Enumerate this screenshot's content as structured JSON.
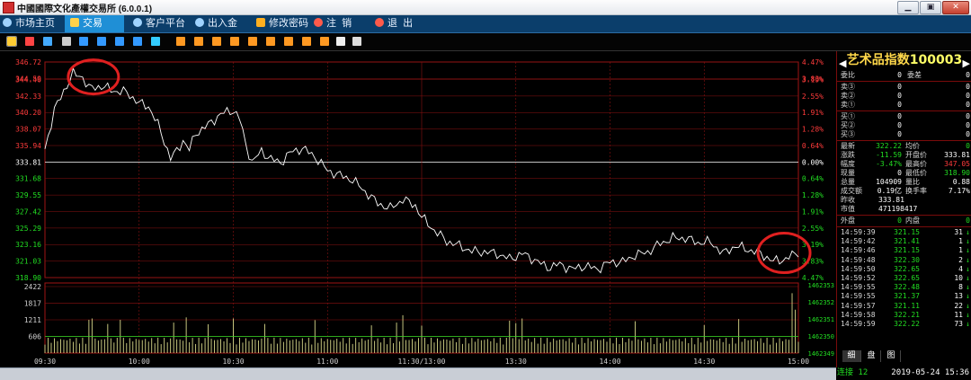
{
  "window": {
    "title": "中國國際文化產權交易所 (6.0.0.1)",
    "controls": [
      "▁",
      "▣",
      "✕"
    ]
  },
  "menu": [
    {
      "label": "市场主页",
      "icon": "home-icon",
      "active": false
    },
    {
      "label": "交易",
      "icon": "trade-icon",
      "active": true
    },
    {
      "label": "客户平台",
      "icon": "client-icon",
      "active": false
    },
    {
      "label": "出入金",
      "icon": "funds-icon",
      "active": false
    },
    {
      "label": "修改密码",
      "icon": "key-icon",
      "active": false
    },
    {
      "label": "注  销",
      "icon": "logout-icon",
      "active": false
    },
    {
      "label": "退  出",
      "icon": "exit-icon",
      "active": false
    }
  ],
  "toolbar_icons": [
    "timeshare-chart-icon",
    "kline-icon",
    "volume-icon",
    "calendar-icon",
    "day-icon",
    "week-icon",
    "month-icon",
    "year-icon",
    "x-icon",
    "tool1-icon",
    "tool2-icon",
    "tool3-icon",
    "tool4-icon",
    "tool5-icon",
    "tool6-icon",
    "tool7-icon",
    "tool8-icon",
    "tool9-icon",
    "notes-icon",
    "settings-icon"
  ],
  "chart_data": {
    "type": "line",
    "title": "",
    "base_price": 333.81,
    "price_ticks": [
      "346.72",
      "344.59",
      "344.46",
      "342.33",
      "340.20",
      "338.07",
      "335.94",
      "333.81",
      "331.68",
      "329.55",
      "327.42",
      "325.29",
      "323.16",
      "321.03",
      "318.90"
    ],
    "price_tick_values": [
      346.72,
      344.59,
      344.46,
      342.33,
      340.2,
      338.07,
      335.94,
      333.81,
      331.68,
      329.55,
      327.42,
      325.29,
      323.16,
      321.03,
      318.9
    ],
    "pct_ticks": [
      "4.47%",
      "3.83%",
      "3.19%",
      "2.55%",
      "1.91%",
      "1.28%",
      "0.64%",
      "0.00%",
      "0.64%",
      "1.28%",
      "1.91%",
      "2.55%",
      "3.19%",
      "3.83%",
      "4.47%"
    ],
    "time_labels": [
      "09:30",
      "10:00",
      "10:30",
      "11:00",
      "11:30/13:00",
      "13:30",
      "14:00",
      "14:30",
      "15:00"
    ],
    "volume_ticks": [
      "2422",
      "1817",
      "1211",
      "606"
    ],
    "volume_tick_values": [
      2422,
      1817,
      1211,
      606
    ],
    "volume_right_ticks": [
      "1462353",
      "1462352",
      "1462351",
      "1462350",
      "1462349"
    ],
    "price_keypoints": [
      [
        0,
        335.5
      ],
      [
        3,
        340.5
      ],
      [
        6,
        343.0
      ],
      [
        9,
        345.2
      ],
      [
        12,
        344.8
      ],
      [
        14,
        343.3
      ],
      [
        18,
        343.6
      ],
      [
        22,
        343.0
      ],
      [
        26,
        342.8
      ],
      [
        30,
        341.4
      ],
      [
        33,
        341.0
      ],
      [
        36,
        338.6
      ],
      [
        38,
        336.5
      ],
      [
        40,
        334.3
      ],
      [
        42,
        335.2
      ],
      [
        44,
        336.6
      ],
      [
        46,
        335.4
      ],
      [
        48,
        337.5
      ],
      [
        52,
        338.6
      ],
      [
        56,
        340.0
      ],
      [
        60,
        340.5
      ],
      [
        62,
        339.4
      ],
      [
        64,
        336.0
      ],
      [
        66,
        333.8
      ],
      [
        69,
        335.2
      ],
      [
        72,
        334.2
      ],
      [
        75,
        333.7
      ],
      [
        78,
        335.0
      ],
      [
        82,
        335.6
      ],
      [
        86,
        334.5
      ],
      [
        90,
        332.7
      ],
      [
        94,
        332.1
      ],
      [
        98,
        331.5
      ],
      [
        102,
        330.0
      ],
      [
        106,
        328.5
      ],
      [
        110,
        327.8
      ],
      [
        114,
        329.0
      ],
      [
        118,
        328.2
      ],
      [
        120,
        326.7
      ],
      [
        124,
        325.0
      ],
      [
        128,
        323.6
      ],
      [
        132,
        323.0
      ],
      [
        136,
        322.3
      ],
      [
        140,
        322.2
      ],
      [
        144,
        322.0
      ],
      [
        148,
        321.3
      ],
      [
        152,
        322.0
      ],
      [
        156,
        321.2
      ],
      [
        160,
        320.2
      ],
      [
        164,
        320.6
      ],
      [
        168,
        320.0
      ],
      [
        172,
        320.4
      ],
      [
        176,
        320.0
      ],
      [
        180,
        320.9
      ],
      [
        184,
        320.9
      ],
      [
        188,
        321.8
      ],
      [
        192,
        322.2
      ],
      [
        196,
        323.3
      ],
      [
        200,
        324.0
      ],
      [
        204,
        324.0
      ],
      [
        208,
        323.4
      ],
      [
        212,
        323.5
      ],
      [
        216,
        322.0
      ],
      [
        220,
        323.0
      ],
      [
        224,
        322.5
      ],
      [
        228,
        322.0
      ],
      [
        232,
        321.0
      ],
      [
        236,
        321.3
      ],
      [
        240,
        322.2
      ]
    ],
    "volume_spikes": [
      [
        14,
        1211
      ],
      [
        15,
        1260
      ],
      [
        20,
        1060
      ],
      [
        24,
        1211
      ],
      [
        41,
        1110
      ],
      [
        45,
        1300
      ],
      [
        52,
        1050
      ],
      [
        60,
        1260
      ],
      [
        70,
        1060
      ],
      [
        86,
        1200
      ],
      [
        104,
        1010
      ],
      [
        112,
        1110
      ],
      [
        114,
        1380
      ],
      [
        120,
        1000
      ],
      [
        148,
        1180
      ],
      [
        150,
        1090
      ],
      [
        152,
        1260
      ],
      [
        188,
        1160
      ],
      [
        210,
        1020
      ],
      [
        221,
        1240
      ],
      [
        238,
        2180
      ],
      [
        239,
        1580
      ]
    ],
    "volume_baseline": 606,
    "volume_base_level": 560,
    "total_minutes": 240
  },
  "side_panel": {
    "title": "艺术品指数",
    "code": "100003",
    "weibi": {
      "label": "委比",
      "value": "0"
    },
    "weicha": {
      "label": "委差",
      "value": "0"
    },
    "sells": [
      {
        "label": "卖③",
        "value": "0",
        "value2": "0"
      },
      {
        "label": "卖②",
        "value": "0",
        "value2": "0"
      },
      {
        "label": "卖①",
        "value": "0",
        "value2": "0"
      }
    ],
    "buys": [
      {
        "label": "买①",
        "value": "0",
        "value2": "0"
      },
      {
        "label": "买②",
        "value": "0",
        "value2": "0"
      },
      {
        "label": "买③",
        "value": "0",
        "value2": "0"
      }
    ],
    "quotes": [
      {
        "l1": "最新",
        "v1": "322.22",
        "l2": "均价",
        "v2": "0"
      },
      {
        "l1": "涨跌",
        "v1": "-11.59",
        "l2": "开盘价",
        "v2": "333.81"
      },
      {
        "l1": "幅度",
        "v1": "-3.47%",
        "l2": "最高价",
        "v2": "347.05"
      },
      {
        "l1": "现量",
        "v1": "0",
        "l2": "最低价",
        "v2": "318.90"
      },
      {
        "l1": "总量",
        "v1": "104909",
        "l2": "量比",
        "v2": "0.88"
      },
      {
        "l1": "成交额",
        "v1": "0.19亿",
        "l2": "换手率",
        "v2": "7.17%"
      },
      {
        "l1": "昨收",
        "v1": "333.81",
        "l2": "",
        "v2": ""
      },
      {
        "l1": "市值",
        "v1": "471198417",
        "l2": "",
        "v2": ""
      }
    ],
    "waipan": {
      "label": "外盘",
      "value": "0"
    },
    "neipan": {
      "label": "内盘",
      "value": "0"
    },
    "ticks": [
      {
        "time": "14:59:39",
        "price": "321.15",
        "vol": "31"
      },
      {
        "time": "14:59:42",
        "price": "321.41",
        "vol": "1"
      },
      {
        "time": "14:59:46",
        "price": "321.15",
        "vol": "1"
      },
      {
        "time": "14:59:48",
        "price": "322.30",
        "vol": "2"
      },
      {
        "time": "14:59:50",
        "price": "322.65",
        "vol": "4"
      },
      {
        "time": "14:59:52",
        "price": "322.65",
        "vol": "10"
      },
      {
        "time": "14:59:55",
        "price": "322.48",
        "vol": "8"
      },
      {
        "time": "14:59:55",
        "price": "321.37",
        "vol": "13"
      },
      {
        "time": "14:59:57",
        "price": "321.11",
        "vol": "22"
      },
      {
        "time": "14:59:58",
        "price": "322.21",
        "vol": "11"
      },
      {
        "time": "14:59:59",
        "price": "322.22",
        "vol": "73"
      }
    ],
    "tabs": [
      "细",
      "盘",
      "图"
    ]
  },
  "status": {
    "conn": "连接 12",
    "datetime": "2019-05-24 15:36"
  }
}
